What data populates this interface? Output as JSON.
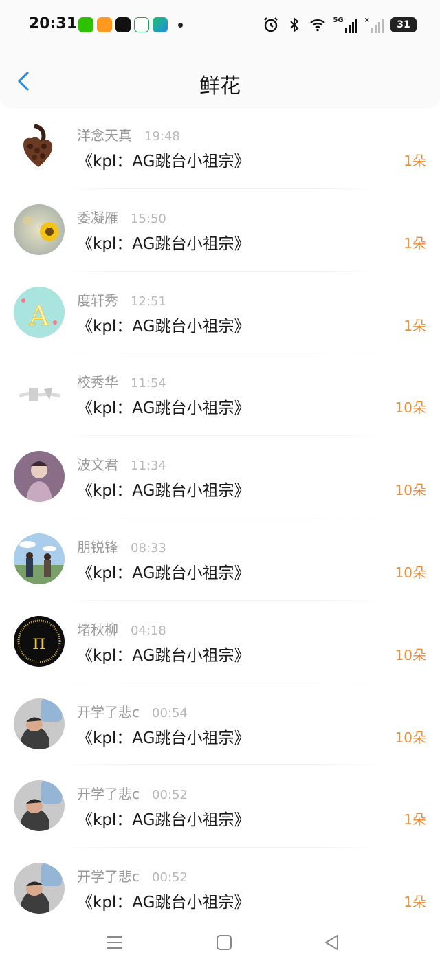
{
  "status": {
    "time": "20:31",
    "network_label": "5G",
    "battery": "31",
    "app_icons": [
      "wechat-icon",
      "orange-app-icon",
      "tiktok-icon",
      "oppo-icon",
      "video-app-icon"
    ],
    "system_icons": [
      "alarm-icon",
      "bluetooth-icon",
      "wifi-icon",
      "signal-5g-icon",
      "signal-weak-icon"
    ]
  },
  "header": {
    "title": "鲜花",
    "back_icon": "chevron-left-icon"
  },
  "colors": {
    "accent": "#2f8bdc",
    "count": "#f08a33"
  },
  "gifts": [
    {
      "sender": "洋念天真",
      "time": "19:48",
      "subject": "《kpl：AG跳台小祖宗》",
      "count": "1朵",
      "avatar": "coffee-heart"
    },
    {
      "sender": "委凝雁",
      "time": "15:50",
      "subject": "《kpl：AG跳台小祖宗》",
      "count": "1朵",
      "avatar": "sunflower"
    },
    {
      "sender": "度轩秀",
      "time": "12:51",
      "subject": "《kpl：AG跳台小祖宗》",
      "count": "1朵",
      "avatar": "letter-a"
    },
    {
      "sender": "校秀华",
      "time": "11:54",
      "subject": "《kpl：AG跳台小祖宗》",
      "count": "10朵",
      "avatar": "sketch"
    },
    {
      "sender": "波文君",
      "time": "11:34",
      "subject": "《kpl：AG跳台小祖宗》",
      "count": "10朵",
      "avatar": "purple-person"
    },
    {
      "sender": "朋锐锋",
      "time": "08:33",
      "subject": "《kpl：AG跳台小祖宗》",
      "count": "10朵",
      "avatar": "anime-sky"
    },
    {
      "sender": "堵秋柳",
      "time": "04:18",
      "subject": "《kpl：AG跳台小祖宗》",
      "count": "10朵",
      "avatar": "pi"
    },
    {
      "sender": "开学了悲c",
      "time": "00:54",
      "subject": "《kpl：AG跳台小祖宗》",
      "count": "10朵",
      "avatar": "water-bottle"
    },
    {
      "sender": "开学了悲c",
      "time": "00:52",
      "subject": "《kpl：AG跳台小祖宗》",
      "count": "1朵",
      "avatar": "water-bottle"
    },
    {
      "sender": "开学了悲c",
      "time": "00:52",
      "subject": "《kpl：AG跳台小祖宗》",
      "count": "1朵",
      "avatar": "water-bottle"
    }
  ],
  "system_nav": [
    "menu-icon",
    "home-square-icon",
    "back-triangle-icon"
  ]
}
